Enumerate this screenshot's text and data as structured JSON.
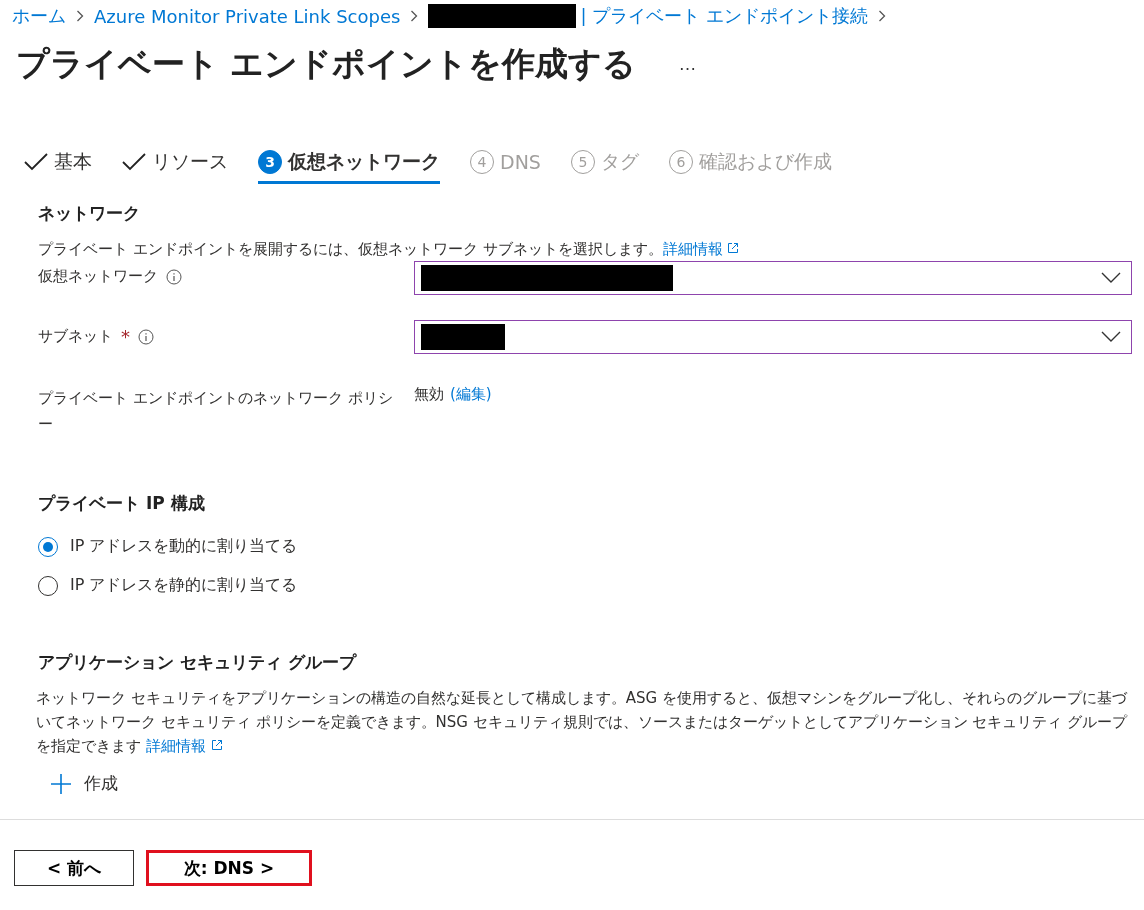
{
  "breadcrumb": [
    {
      "label": "ホーム",
      "redacted": false
    },
    {
      "label": "Azure Monitor Private Link Scopes",
      "redacted": false
    },
    {
      "label": "| プライベート エンドポイント接続",
      "redacted": true
    }
  ],
  "title": "プライベート エンドポイントを作成する",
  "more": "…",
  "tabs": [
    {
      "label": "基本",
      "completed": true,
      "selected": false,
      "disabled": false
    },
    {
      "label": "リソース",
      "completed": true,
      "selected": false,
      "disabled": false
    },
    {
      "label": "仮想ネットワーク",
      "number": "3",
      "completed": false,
      "selected": true,
      "disabled": false
    },
    {
      "label": "DNS",
      "number": "4",
      "completed": false,
      "selected": false,
      "disabled": true
    },
    {
      "label": "タグ",
      "number": "5",
      "completed": false,
      "selected": false,
      "disabled": true
    },
    {
      "label": "確認および作成",
      "number": "6",
      "completed": false,
      "selected": false,
      "disabled": true
    }
  ],
  "network": {
    "heading": "ネットワーク",
    "description": "プライベート エンドポイントを展開するには、仮想ネットワーク サブネットを選択します。",
    "link": "詳細情報",
    "fields": [
      {
        "kind": "dropdown",
        "label": "仮想ネットワーク",
        "info": true,
        "redacted": true
      },
      {
        "kind": "dropdown",
        "label": "サブネット",
        "required_mark": "*",
        "info": true,
        "redacted": true
      },
      {
        "kind": "value",
        "label": "プライベート エンドポイントのネットワーク ポリシー",
        "value": "無効",
        "link": "(編集)"
      }
    ]
  },
  "ip_config": {
    "heading": "プライベート IP 構成",
    "options": [
      {
        "label": "IP アドレスを動的に割り当てる",
        "selected": true
      },
      {
        "label": "IP アドレスを静的に割り当てる",
        "selected": false
      }
    ]
  },
  "asg": {
    "heading": "アプリケーション セキュリティ グループ",
    "description": "ネットワーク セキュリティをアプリケーションの構造の自然な延長として構成します。ASG を使用すると、仮想マシンをグループ化し、それらのグループに基づいてネットワーク セキュリティ ポリシーを定義できます。NSG セキュリティ規則では、ソースまたはターゲットとしてアプリケーション セキュリティ グループを指定できます",
    "link": "詳細情報",
    "create": "作成"
  },
  "footer": [
    {
      "label": "< 前へ",
      "highlighted": false
    },
    {
      "label": "次: DNS >",
      "highlighted": true
    }
  ]
}
